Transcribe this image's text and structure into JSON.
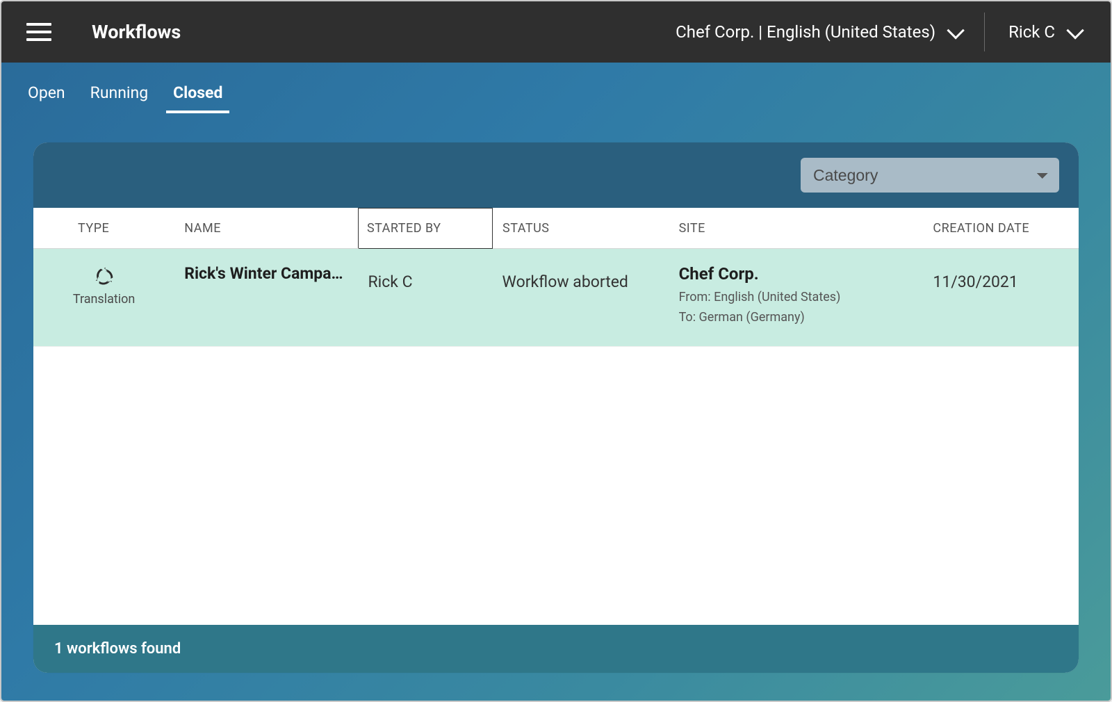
{
  "header": {
    "title": "Workflows",
    "site_label": "Chef Corp. | English (United States)",
    "user_label": "Rick C"
  },
  "tabs": [
    {
      "label": "Open",
      "active": false
    },
    {
      "label": "Running",
      "active": false
    },
    {
      "label": "Closed",
      "active": true
    }
  ],
  "filter": {
    "category_placeholder": "Category"
  },
  "columns": {
    "type": "TYPE",
    "name": "NAME",
    "started_by": "STARTED BY",
    "status": "STATUS",
    "site": "SITE",
    "creation_date": "CREATION DATE"
  },
  "rows": [
    {
      "type_label": "Translation",
      "name": "Rick's Winter Campa…",
      "started_by": "Rick C",
      "status": "Workflow aborted",
      "site": {
        "name": "Chef Corp.",
        "from": "From: English (United States)",
        "to": "To: German (Germany)"
      },
      "creation_date": "11/30/2021"
    }
  ],
  "footer": {
    "count_text": "1 workflows found"
  }
}
